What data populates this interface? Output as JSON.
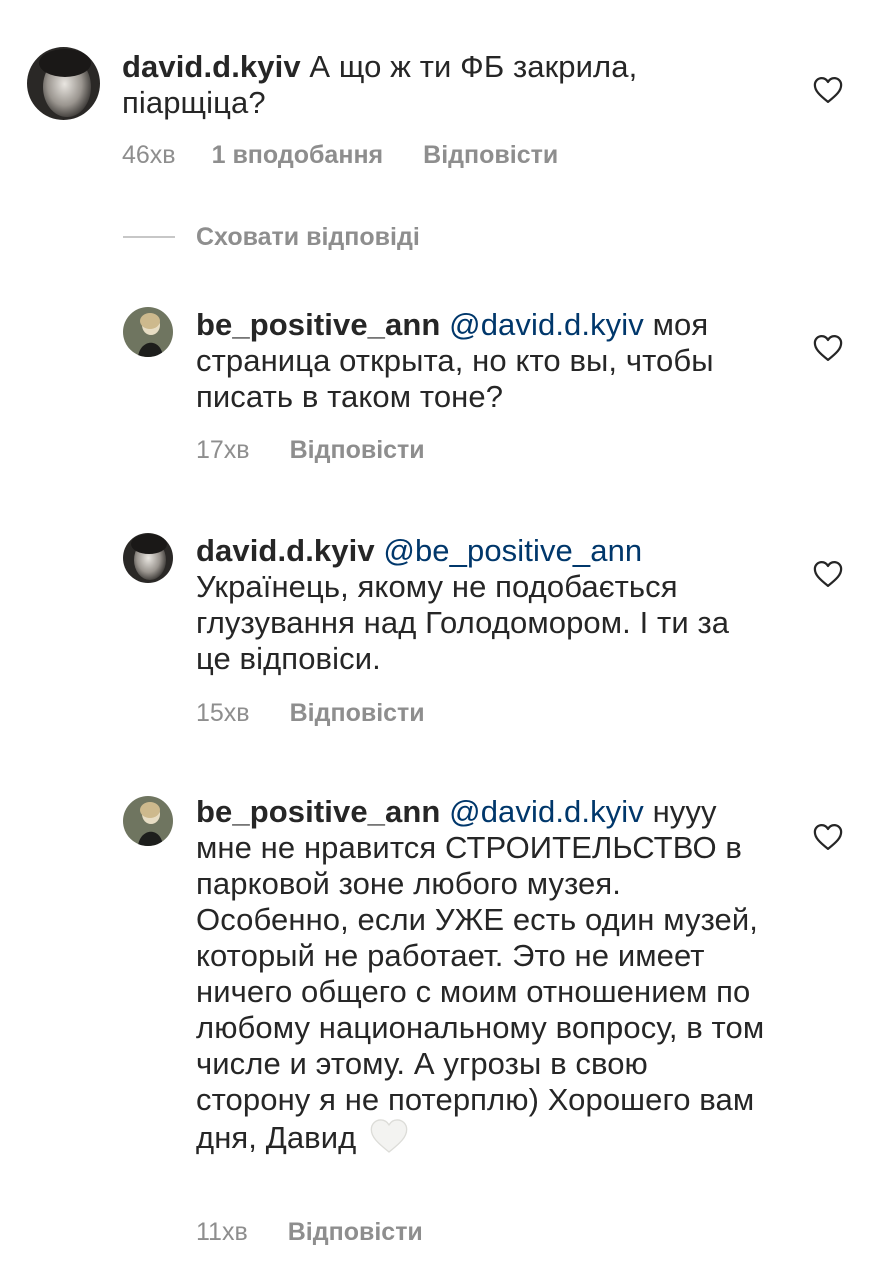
{
  "comments": [
    {
      "username": "david.d.kyiv",
      "mention": "",
      "text": " А що ж ти ФБ закрила, піарщіца?",
      "time": "46хв",
      "likes": "1 вподобання",
      "reply": "Відповісти"
    },
    {
      "username": "be_positive_ann",
      "mention": "@david.d.kyiv",
      "text": " моя страница открыта, но кто вы, чтобы писать в таком тоне?",
      "time": "17хв",
      "reply": "Відповісти"
    },
    {
      "username": "david.d.kyiv",
      "mention": "@be_positive_ann",
      "text": "Українець, якому не подобається глузування над Голодомором. І ти за це відповіси.",
      "time": "15хв",
      "reply": "Відповісти"
    },
    {
      "username": "be_positive_ann",
      "mention": "@david.d.kyiv",
      "text": " нууу мне не нравится СТРОИТЕЛЬСТВО в парковой зоне любого музея. Особенно, если УЖЕ есть один музей, который не работает. Это не имеет ничего общего с моим отношением по любому национальному вопросу, в том числе и этому. А угрозы в свою сторону я не потерплю) Хорошего вам дня, Давид",
      "emoji": "white-heart-emoji",
      "time": "11хв",
      "reply": "Відповісти"
    }
  ],
  "hide_replies": "Сховати відповіді",
  "colors": {
    "text": "#262626",
    "secondary": "#8e8e8e",
    "mention": "#00376b",
    "divider": "#c7c7c7"
  },
  "icons": {
    "like": "heart-outline-icon",
    "avatar": "user-avatar"
  }
}
